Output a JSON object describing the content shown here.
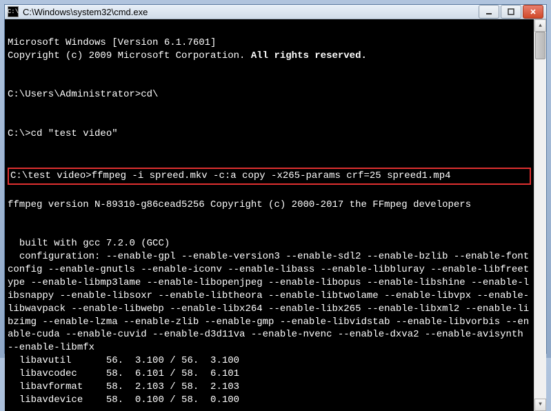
{
  "window": {
    "title": "C:\\Windows\\system32\\cmd.exe"
  },
  "console": {
    "line1": "Microsoft Windows [Version 6.1.7601]",
    "line2a": "Copyright (c) 2009 Microsoft Corporation. ",
    "line2b": "All rights reserved.",
    "line3": "C:\\Users\\Administrator>cd\\",
    "line4": "C:\\>cd \"test video\"",
    "highlighted": "C:\\test video>ffmpeg -i spreed.mkv -c:a copy -x265-params crf=25 spreed1.mp4",
    "line5": "ffmpeg version N-89310-g86cead5256 Copyright (c) 2000-2017 the FFmpeg developers",
    "line6": "  built with gcc 7.2.0 (GCC)",
    "line7": "  configuration: --enable-gpl --enable-version3 --enable-sdl2 --enable-bzlib --enable-fontconfig --enable-gnutls --enable-iconv --enable-libass --enable-libbluray --enable-libfreetype --enable-libmp3lame --enable-libopenjpeg --enable-libopus --enable-libshine --enable-libsnappy --enable-libsoxr --enable-libtheora --enable-libtwolame --enable-libvpx --enable-libwavpack --enable-libwebp --enable-libx264 --enable-libx265 --enable-libxml2 --enable-libzimg --enable-lzma --enable-zlib --enable-gmp --enable-libvidstab --enable-libvorbis --enable-cuda --enable-cuvid --enable-d3d11va --enable-nvenc --enable-dxva2 --enable-avisynth --enable-libmfx",
    "lib1": "  libavutil      56.  3.100 / 56.  3.100",
    "lib2": "  libavcodec     58.  6.101 / 58.  6.101",
    "lib3": "  libavformat    58.  2.103 / 58.  2.103",
    "lib4": "  libavdevice    58.  0.100 / 58.  0.100"
  },
  "icons": {
    "app": "C:\\"
  }
}
